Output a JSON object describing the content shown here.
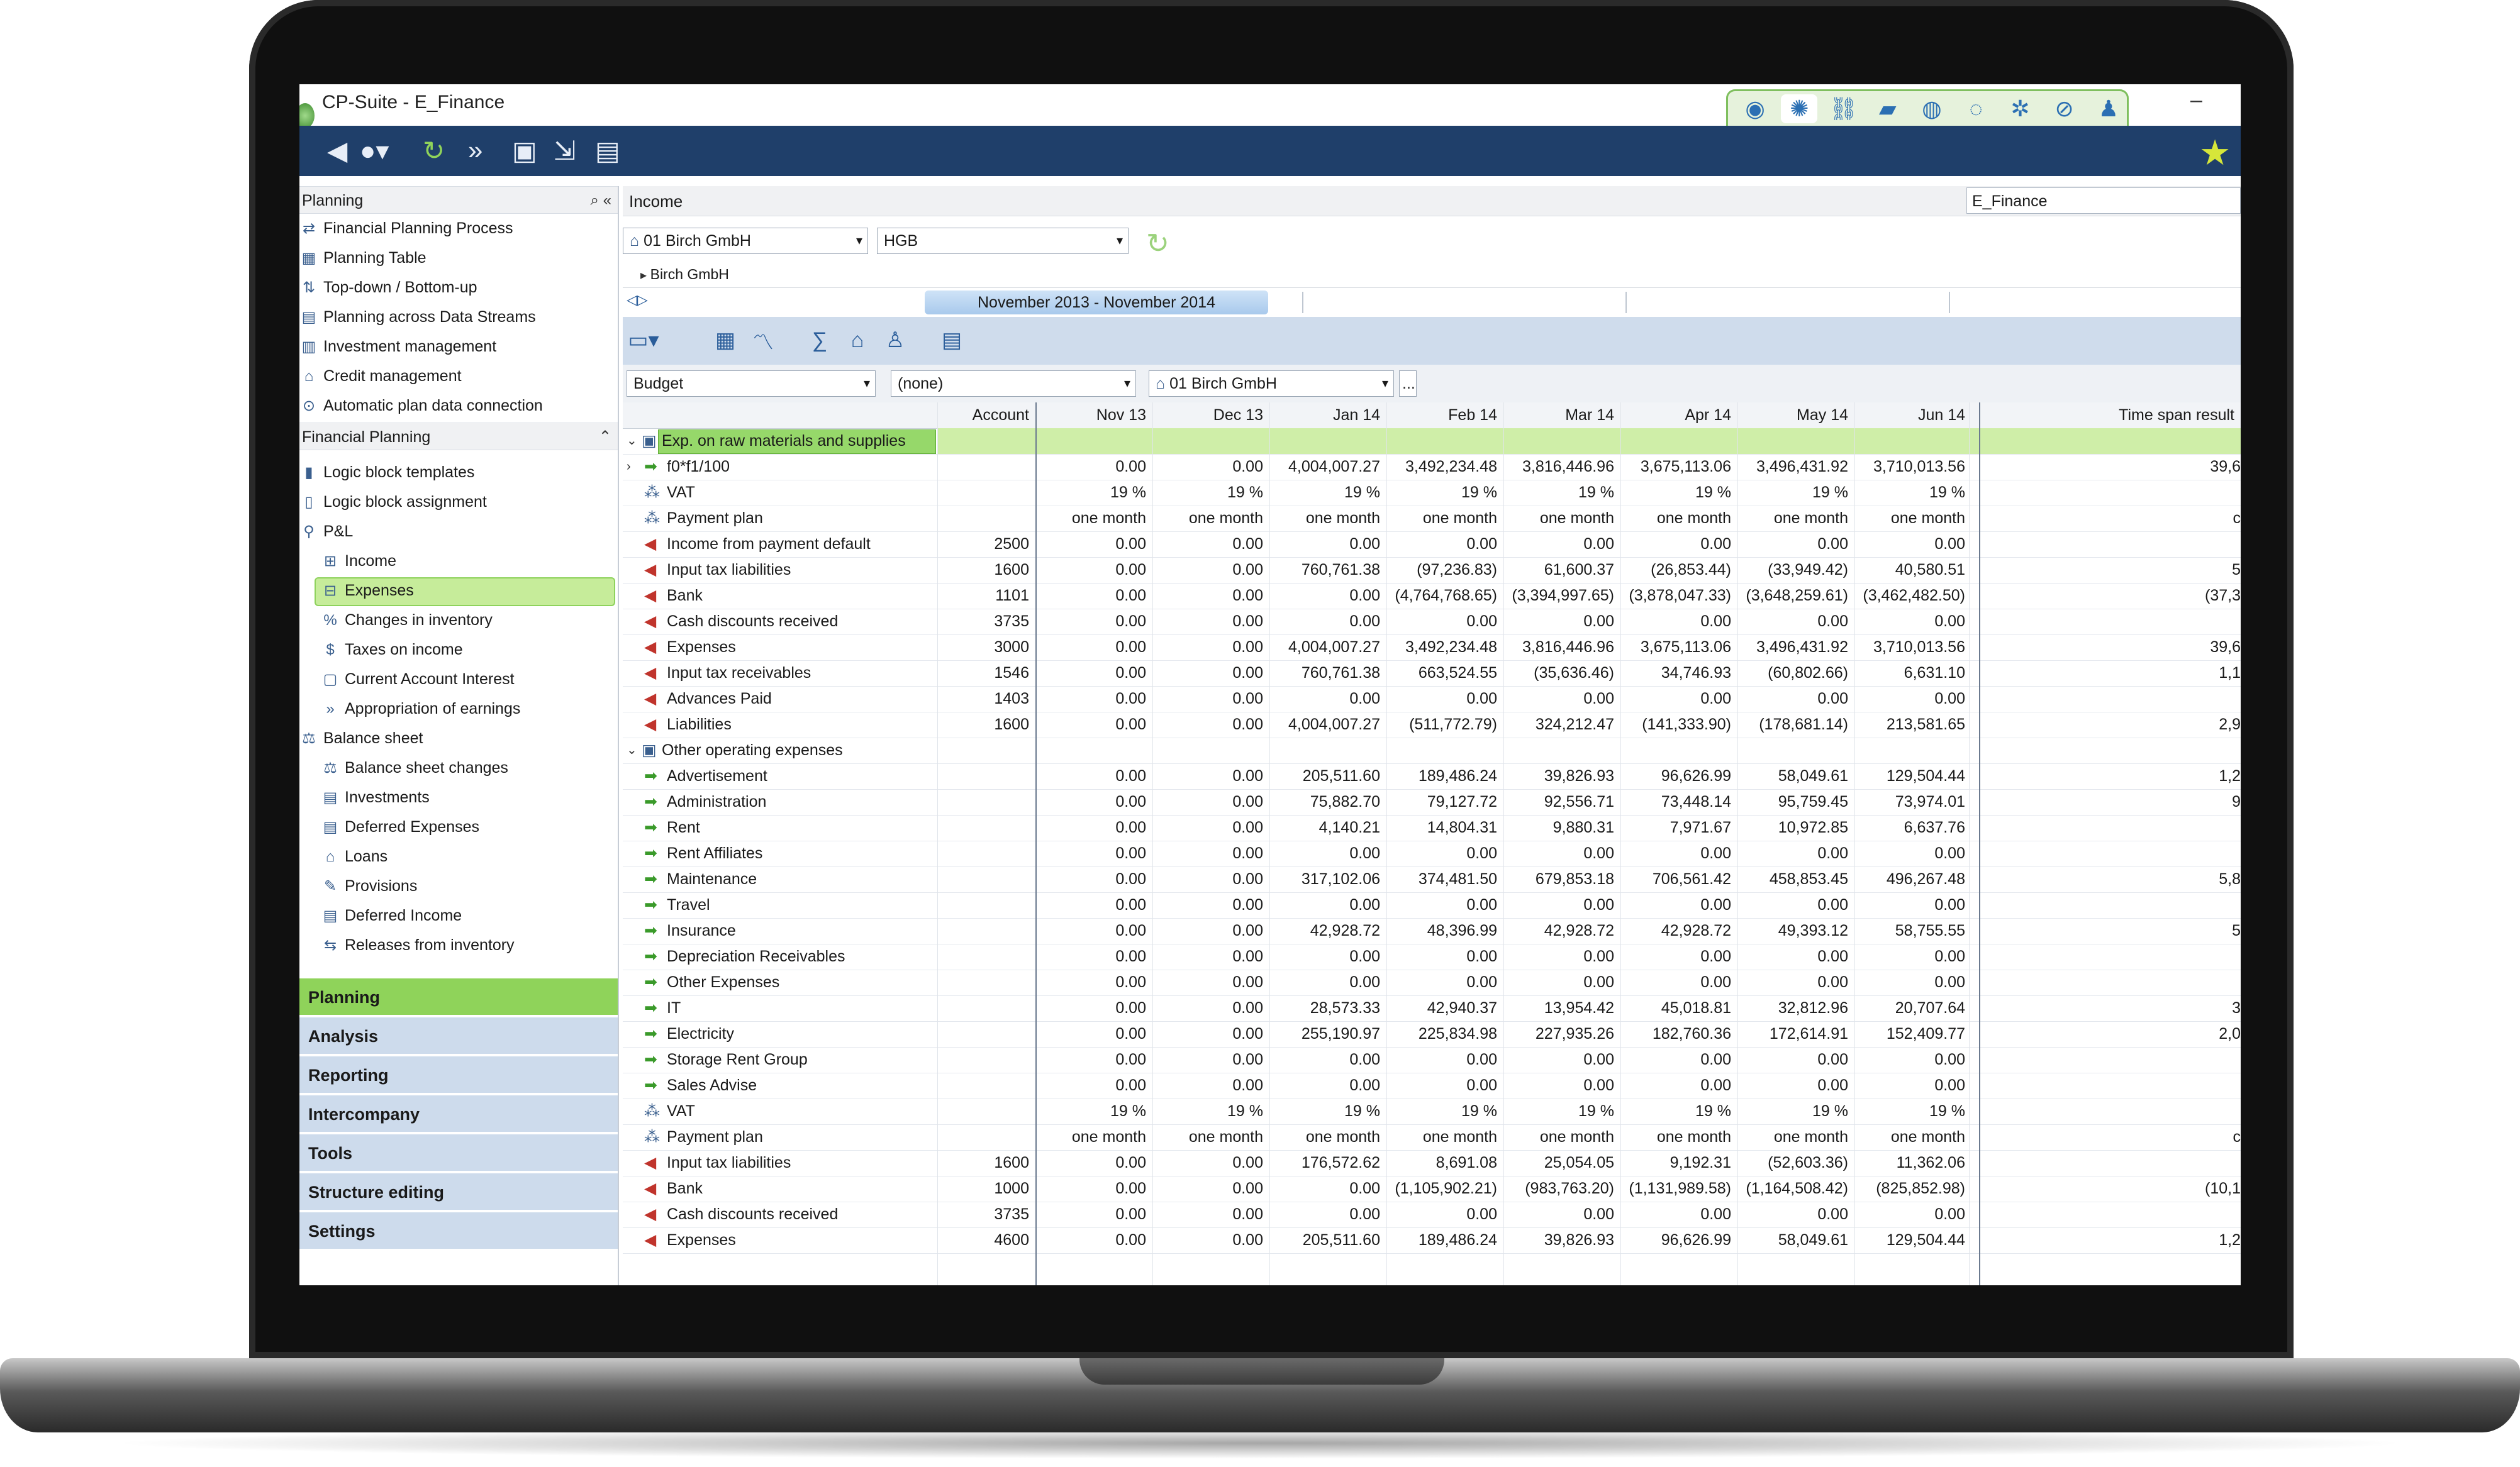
{
  "window": {
    "title": "CP-Suite - E_Finance",
    "minimize": "–"
  },
  "module_icons": [
    "globe-icon",
    "gear-globe-icon",
    "link-icon",
    "money-icon",
    "world-icon",
    "sync-icon",
    "settings-icon",
    "check-icon",
    "user-icon"
  ],
  "toolbar_icons": [
    "back-icon",
    "forward-icon",
    "refresh-icon",
    "fast-forward-icon",
    "layout-icon",
    "export-icon",
    "table-icon"
  ],
  "sidebar": {
    "planning_header": "Planning",
    "planning_items": [
      "Financial Planning Process",
      "Planning Table",
      "Top-down / Bottom-up",
      "Planning across Data Streams",
      "Investment management",
      "Credit management",
      "Automatic plan data connection"
    ],
    "financial_header": "Financial Planning",
    "financial_items": [
      "Logic block templates",
      "Logic block assignment",
      "P&L",
      "Income",
      "Expenses",
      "Changes in inventory",
      "Taxes on income",
      "Current Account Interest",
      "Appropriation of earnings",
      "Balance sheet",
      "Balance sheet changes",
      "Investments",
      "Deferred Expenses",
      "Loans",
      "Provisions",
      "Deferred Income",
      "Releases from inventory"
    ],
    "modules": [
      "Planning",
      "Analysis",
      "Reporting",
      "Intercompany",
      "Tools",
      "Structure editing",
      "Settings"
    ]
  },
  "main": {
    "header_title": "Income",
    "header_right": "E_Finance",
    "company_select": "01 Birch GmbH",
    "standard_select": "HGB",
    "breadcrumb": "Birch GmbH",
    "period_range": "November 2013 - November 2014",
    "scenario_select": "Budget",
    "second_select": "(none)",
    "company_select_2": "01 Birch GmbH",
    "more_button": "..."
  },
  "grid": {
    "columns": [
      "Account",
      "Nov 13",
      "Dec 13",
      "Jan 14",
      "Feb 14",
      "Mar 14",
      "Apr 14",
      "May 14",
      "Jun 14",
      "Time span result"
    ],
    "rows": [
      {
        "label": "Exp. on raw materials and supplies",
        "kind": "group-hl",
        "values": []
      },
      {
        "label": "f0*f1/100",
        "kind": "green",
        "account": "",
        "values": [
          "0.00",
          "0.00",
          "4,004,007.27",
          "3,492,234.48",
          "3,816,446.96",
          "3,675,113.06",
          "3,496,431.92",
          "3,710,013.56"
        ],
        "result": "39,6"
      },
      {
        "label": "VAT",
        "kind": "blue",
        "account": "",
        "values": [
          "19 %",
          "19 %",
          "19 %",
          "19 %",
          "19 %",
          "19 %",
          "19 %",
          "19 %"
        ],
        "result": ""
      },
      {
        "label": "Payment plan",
        "kind": "blue",
        "account": "",
        "values": [
          "one month",
          "one month",
          "one month",
          "one month",
          "one month",
          "one month",
          "one month",
          "one month"
        ],
        "result": "c"
      },
      {
        "label": "Income from payment default",
        "kind": "red",
        "account": "2500",
        "values": [
          "0.00",
          "0.00",
          "0.00",
          "0.00",
          "0.00",
          "0.00",
          "0.00",
          "0.00"
        ],
        "result": ""
      },
      {
        "label": "Input tax liabilities",
        "kind": "red",
        "account": "1600",
        "values": [
          "0.00",
          "0.00",
          "760,761.38",
          "(97,236.83)",
          "61,600.37",
          "(26,853.44)",
          "(33,949.42)",
          "40,580.51"
        ],
        "result": "5"
      },
      {
        "label": "Bank",
        "kind": "red",
        "account": "1101",
        "values": [
          "0.00",
          "0.00",
          "0.00",
          "(4,764,768.65)",
          "(3,394,997.65)",
          "(3,878,047.33)",
          "(3,648,259.61)",
          "(3,462,482.50)"
        ],
        "result": "(37,3"
      },
      {
        "label": "Cash discounts received",
        "kind": "red",
        "account": "3735",
        "values": [
          "0.00",
          "0.00",
          "0.00",
          "0.00",
          "0.00",
          "0.00",
          "0.00",
          "0.00"
        ],
        "result": ""
      },
      {
        "label": "Expenses",
        "kind": "red",
        "account": "3000",
        "values": [
          "0.00",
          "0.00",
          "4,004,007.27",
          "3,492,234.48",
          "3,816,446.96",
          "3,675,113.06",
          "3,496,431.92",
          "3,710,013.56"
        ],
        "result": "39,6"
      },
      {
        "label": "Input tax receivables",
        "kind": "red",
        "account": "1546",
        "values": [
          "0.00",
          "0.00",
          "760,761.38",
          "663,524.55",
          "(35,636.46)",
          "34,746.93",
          "(60,802.66)",
          "6,631.10"
        ],
        "result": "1,1"
      },
      {
        "label": "Advances Paid",
        "kind": "red",
        "account": "1403",
        "values": [
          "0.00",
          "0.00",
          "0.00",
          "0.00",
          "0.00",
          "0.00",
          "0.00",
          "0.00"
        ],
        "result": ""
      },
      {
        "label": "Liabilities",
        "kind": "red",
        "account": "1600",
        "values": [
          "0.00",
          "0.00",
          "4,004,007.27",
          "(511,772.79)",
          "324,212.47",
          "(141,333.90)",
          "(178,681.14)",
          "213,581.65"
        ],
        "result": "2,9"
      },
      {
        "label": "Other operating expenses",
        "kind": "group",
        "values": []
      },
      {
        "label": "Advertisement",
        "kind": "green",
        "account": "",
        "values": [
          "0.00",
          "0.00",
          "205,511.60",
          "189,486.24",
          "39,826.93",
          "96,626.99",
          "58,049.61",
          "129,504.44"
        ],
        "result": "1,2"
      },
      {
        "label": "Administration",
        "kind": "green",
        "account": "",
        "values": [
          "0.00",
          "0.00",
          "75,882.70",
          "79,127.72",
          "92,556.71",
          "73,448.14",
          "95,759.45",
          "73,974.01"
        ],
        "result": "9"
      },
      {
        "label": "Rent",
        "kind": "green",
        "account": "",
        "values": [
          "0.00",
          "0.00",
          "4,140.21",
          "14,804.31",
          "9,880.31",
          "7,971.67",
          "10,972.85",
          "6,637.76"
        ],
        "result": ""
      },
      {
        "label": "Rent Affiliates",
        "kind": "green",
        "account": "",
        "values": [
          "0.00",
          "0.00",
          "0.00",
          "0.00",
          "0.00",
          "0.00",
          "0.00",
          "0.00"
        ],
        "result": ""
      },
      {
        "label": "Maintenance",
        "kind": "green",
        "account": "",
        "values": [
          "0.00",
          "0.00",
          "317,102.06",
          "374,481.50",
          "679,853.18",
          "706,561.42",
          "458,853.45",
          "496,267.48"
        ],
        "result": "5,8"
      },
      {
        "label": "Travel",
        "kind": "green",
        "account": "",
        "values": [
          "0.00",
          "0.00",
          "0.00",
          "0.00",
          "0.00",
          "0.00",
          "0.00",
          "0.00"
        ],
        "result": ""
      },
      {
        "label": "Insurance",
        "kind": "green",
        "account": "",
        "values": [
          "0.00",
          "0.00",
          "42,928.72",
          "48,396.99",
          "42,928.72",
          "42,928.72",
          "49,393.12",
          "58,755.55"
        ],
        "result": "5"
      },
      {
        "label": "Depreciation Receivables",
        "kind": "green",
        "account": "",
        "values": [
          "0.00",
          "0.00",
          "0.00",
          "0.00",
          "0.00",
          "0.00",
          "0.00",
          "0.00"
        ],
        "result": ""
      },
      {
        "label": "Other Expenses",
        "kind": "green",
        "account": "",
        "values": [
          "0.00",
          "0.00",
          "0.00",
          "0.00",
          "0.00",
          "0.00",
          "0.00",
          "0.00"
        ],
        "result": ""
      },
      {
        "label": "IT",
        "kind": "green",
        "account": "",
        "values": [
          "0.00",
          "0.00",
          "28,573.33",
          "42,940.37",
          "13,954.42",
          "45,018.81",
          "32,812.96",
          "20,707.64"
        ],
        "result": "3"
      },
      {
        "label": "Electricity",
        "kind": "green",
        "account": "",
        "values": [
          "0.00",
          "0.00",
          "255,190.97",
          "225,834.98",
          "227,935.26",
          "182,760.36",
          "172,614.91",
          "152,409.77"
        ],
        "result": "2,0"
      },
      {
        "label": "Storage Rent Group",
        "kind": "green",
        "account": "",
        "values": [
          "0.00",
          "0.00",
          "0.00",
          "0.00",
          "0.00",
          "0.00",
          "0.00",
          "0.00"
        ],
        "result": ""
      },
      {
        "label": "Sales Advise",
        "kind": "green",
        "account": "",
        "values": [
          "0.00",
          "0.00",
          "0.00",
          "0.00",
          "0.00",
          "0.00",
          "0.00",
          "0.00"
        ],
        "result": ""
      },
      {
        "label": "VAT",
        "kind": "blue",
        "account": "",
        "values": [
          "19 %",
          "19 %",
          "19 %",
          "19 %",
          "19 %",
          "19 %",
          "19 %",
          "19 %"
        ],
        "result": ""
      },
      {
        "label": "Payment plan",
        "kind": "blue",
        "account": "",
        "values": [
          "one month",
          "one month",
          "one month",
          "one month",
          "one month",
          "one month",
          "one month",
          "one month"
        ],
        "result": "c"
      },
      {
        "label": "Input tax liabilities",
        "kind": "red",
        "account": "1600",
        "values": [
          "0.00",
          "0.00",
          "176,572.62",
          "8,691.08",
          "25,054.05",
          "9,192.31",
          "(52,603.36)",
          "11,362.06"
        ],
        "result": ""
      },
      {
        "label": "Bank",
        "kind": "red",
        "account": "1000",
        "values": [
          "0.00",
          "0.00",
          "0.00",
          "(1,105,902.21)",
          "(983,763.20)",
          "(1,131,989.58)",
          "(1,164,508.42)",
          "(825,852.98)"
        ],
        "result": "(10,1"
      },
      {
        "label": "Cash discounts received",
        "kind": "red",
        "account": "3735",
        "values": [
          "0.00",
          "0.00",
          "0.00",
          "0.00",
          "0.00",
          "0.00",
          "0.00",
          "0.00"
        ],
        "result": ""
      },
      {
        "label": "Expenses",
        "kind": "red",
        "account": "4600",
        "values": [
          "0.00",
          "0.00",
          "205,511.60",
          "189,486.24",
          "39,826.93",
          "96,626.99",
          "58,049.61",
          "129,504.44"
        ],
        "result": "1,2"
      }
    ]
  },
  "colors": {
    "toolbar": "#1f3f6a",
    "accent_green": "#8fd35a",
    "selection": "#c6ec9a",
    "module_nav": "#cddbec"
  }
}
